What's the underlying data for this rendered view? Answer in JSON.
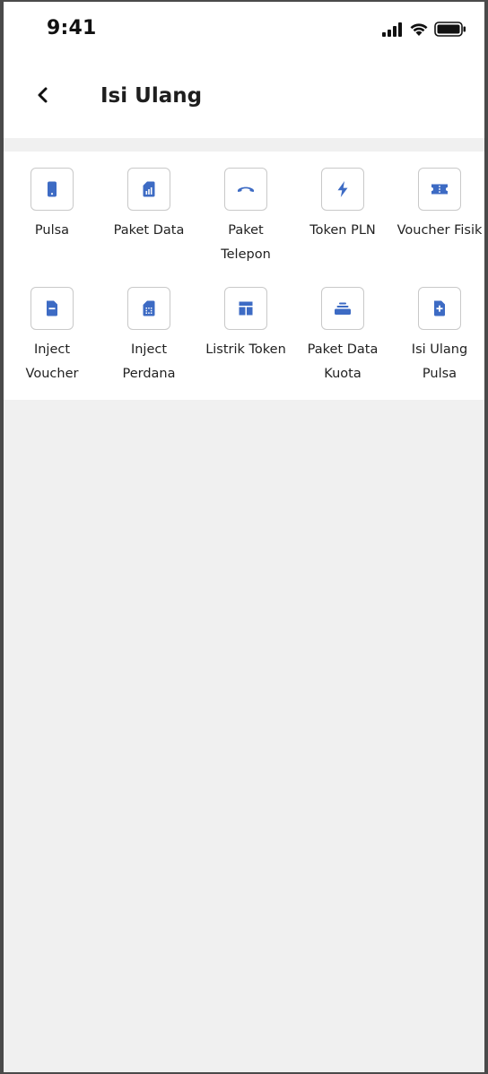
{
  "status_bar": {
    "time": "9:41",
    "icons": [
      "signal-icon",
      "wifi-icon",
      "battery-icon"
    ]
  },
  "header": {
    "back_icon": "chevron-left-icon",
    "title": "Isi Ulang"
  },
  "colors": {
    "accent": "#3d6bc4",
    "background": "#f0f0f0",
    "card": "#ffffff",
    "icon_border": "#c9c9c9"
  },
  "menu": {
    "items": [
      {
        "label": "Pulsa",
        "icon": "phone-icon"
      },
      {
        "label": "Paket Data",
        "icon": "sim-signal-icon"
      },
      {
        "label": "Paket\nTelepon",
        "icon": "call-end-icon"
      },
      {
        "label": "Token PLN",
        "icon": "bolt-icon"
      },
      {
        "label": "Voucher Fisik",
        "icon": "ticket-icon"
      },
      {
        "label": "Inject\nVoucher",
        "icon": "document-minus-icon"
      },
      {
        "label": "Inject\nPerdana",
        "icon": "sim-card-icon"
      },
      {
        "label": "Listrik Token",
        "icon": "layout-icon"
      },
      {
        "label": "Paket Data\nKuota",
        "icon": "layers-icon"
      },
      {
        "label": "Isi Ulang\nPulsa",
        "icon": "document-plus-icon"
      }
    ]
  }
}
